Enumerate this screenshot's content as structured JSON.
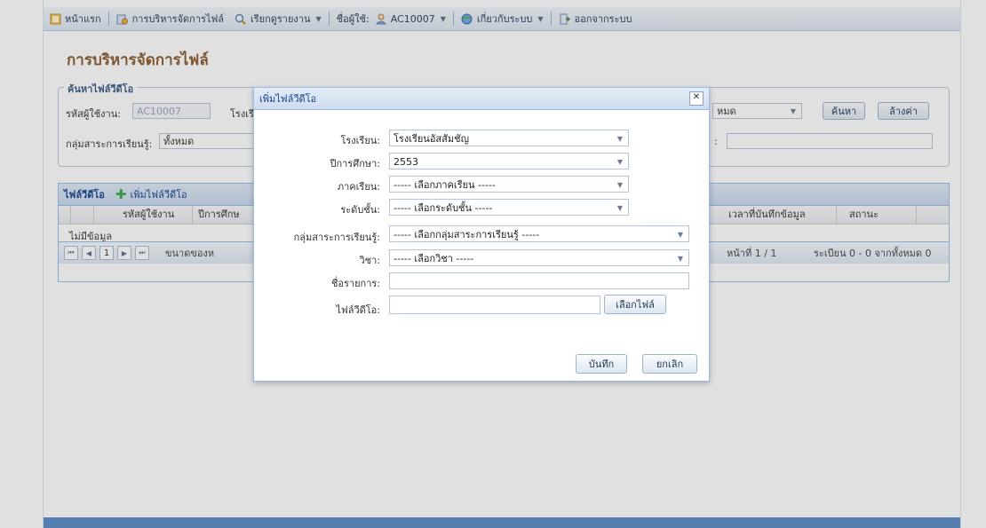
{
  "menu": {
    "home": "หน้าแรก",
    "file_mgmt": "การบริหารจัดการไฟล์",
    "reports": "เรียกดูรายงาน",
    "user_prefix": "ชื่อผู้ใช้:",
    "user": "AC10007",
    "about": "เกี่ยวกับระบบ",
    "logout": "ออกจากระบบ"
  },
  "page": {
    "title": "การบริหารจัดการไฟล์"
  },
  "search": {
    "legend": "ค้นหาไฟล์วีดีโอ",
    "user_code_label": "รหัสผู้ใช้งาน:",
    "user_code_value": "AC10007",
    "school_label_partial": "โรงเรี",
    "subject_group_label": "กลุ่มสาระการเรียนรู้:",
    "subject_group_value": "ทั้งหมด",
    "right_select_value": "หมด",
    "right_label_partial": ":",
    "search_button": "ค้นหา",
    "clear_button": "ล้างค่า"
  },
  "grid": {
    "title": "ไฟล์วีดีโอ",
    "add_label": "เพิ่มไฟล์วีดีโอ",
    "columns": [
      "รหัสผู้ใช้งาน",
      "ปีการศึกษ",
      "เวลาที่บันทึกข้อมูล",
      "สถานะ"
    ],
    "empty_text": "ไม่มีข้อมูล",
    "page_number": "1",
    "page_size_partial": "ขนาดของห",
    "page_info": "หน้าที่ 1 / 1",
    "record_info": "ระเบียน 0 - 0 จากทั้งหมด 0"
  },
  "dialog": {
    "title": "เพิ่มไฟล์วีดีโอ",
    "close": "✕",
    "fields": {
      "school_label": "โรงเรียน:",
      "school_value": "โรงเรียนอัสสัมชัญ",
      "year_label": "ปีการศึกษา:",
      "year_value": "2553",
      "term_label": "ภาคเรียน:",
      "term_value": "----- เลือกภาคเรียน -----",
      "level_label": "ระดับชั้น:",
      "level_value": "----- เลือกระดับชั้น -----",
      "group_label": "กลุ่มสาระการเรียนรู้:",
      "group_value": "----- เลือกกลุ่มสาระการเรียนรู้ -----",
      "subject_label": "วิชา:",
      "subject_value": "----- เลือกวิชา -----",
      "item_name_label": "ชื่อรายการ:",
      "item_name_value": "",
      "video_file_label": "ไฟล์วีดีโอ:",
      "video_file_value": ""
    },
    "browse_button": "เลือกไฟล์",
    "save_button": "บันทึก",
    "cancel_button": "ยกเลิก"
  }
}
